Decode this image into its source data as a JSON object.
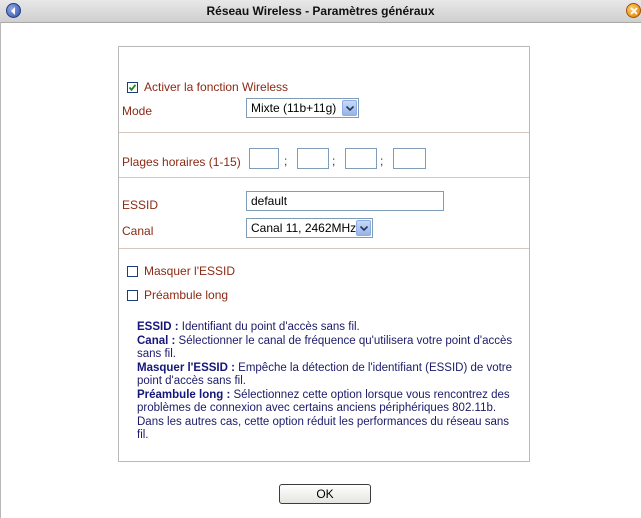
{
  "window": {
    "title": "Réseau Wireless - Paramètres généraux"
  },
  "form": {
    "enable_wireless": {
      "label": "Activer la fonction Wireless",
      "checked": true
    },
    "mode": {
      "label": "Mode",
      "value": "Mixte (11b+11g)"
    },
    "time_ranges": {
      "label": "Plages horaires (1-15)",
      "separator": ";",
      "values": [
        "",
        "",
        "",
        ""
      ]
    },
    "essid": {
      "label": "ESSID",
      "value": "default"
    },
    "channel": {
      "label": "Canal",
      "value": "Canal 11, 2462MHz"
    },
    "hide_essid": {
      "label": "Masquer l'ESSID",
      "checked": false
    },
    "long_preamble": {
      "label": "Préambule long",
      "checked": false
    }
  },
  "help": {
    "essid_term": "ESSID :",
    "essid_text": "Identifiant du point d'accès sans fil.",
    "channel_term": "Canal :",
    "channel_text": "Sélectionner le canal de fréquence qu'utilisera votre point d'accès sans fil.",
    "hide_term": "Masquer l'ESSID :",
    "hide_text": "Empêche la détection de l'identifiant (ESSID) de votre point d'accès sans fil.",
    "preamble_term": "Préambule long :",
    "preamble_text": "Sélectionnez cette option lorsque vous rencontrez des problèmes de connexion avec certains anciens périphériques 802.11b. Dans les autres cas, cette option réduit les performances du réseau sans fil."
  },
  "buttons": {
    "ok": "OK"
  },
  "icons": {
    "back": "back-arrow-icon",
    "close": "close-icon",
    "dropdown": "chevron-down-icon",
    "check": "check-icon"
  },
  "colors": {
    "label": "#8b2a14",
    "help_text": "#1b1b6a",
    "panel_border": "#b9b9b9",
    "separator": "#d6c7bf"
  }
}
